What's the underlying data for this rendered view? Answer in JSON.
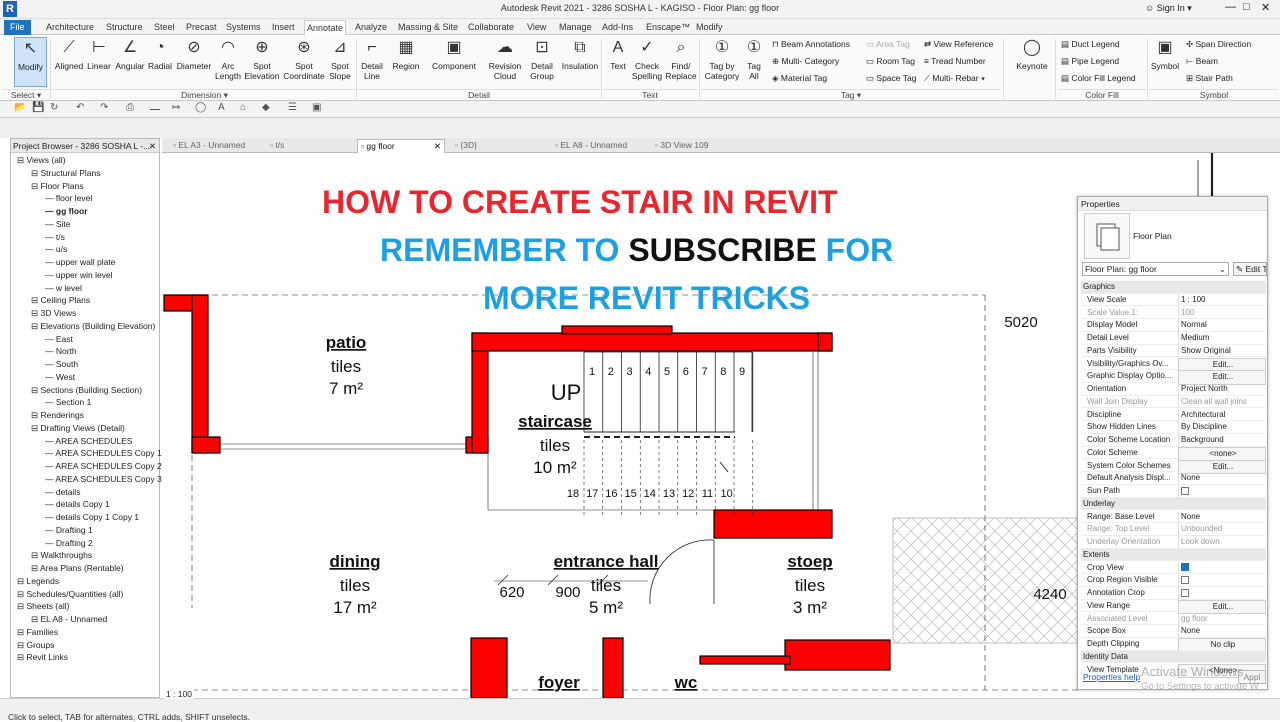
{
  "window": {
    "title": "Autodesk Revit 2021 - 3286 SOSHA L - KAGISO - Floor Plan: gg floor",
    "sign_in": "Sign In",
    "app_letter": "R"
  },
  "ribbon_tabs": [
    "File",
    "Architecture",
    "Structure",
    "Steel",
    "Precast",
    "Systems",
    "Insert",
    "Annotate",
    "Analyze",
    "Massing & Site",
    "Collaborate",
    "View",
    "Manage",
    "Add-Ins",
    "Enscape™",
    "Modify"
  ],
  "active_tab": "Annotate",
  "ribbon": {
    "modify": "Modify",
    "select": "Select ▾",
    "dimension": [
      "Aligned",
      "Linear",
      "Angular",
      "Radial",
      "Diameter",
      "Arc Length",
      "Spot Elevation",
      "Spot Coordinate",
      "Spot Slope"
    ],
    "dimension_group": "Dimension ▾",
    "detail": [
      "Detail Line",
      "Region",
      "Component",
      "Revision Cloud",
      "Detail Group",
      "Insulation"
    ],
    "detail_group": "Detail",
    "text": [
      "Text",
      "Check Spelling",
      "Find/ Replace"
    ],
    "text_group": "Text",
    "tag": [
      "Tag by Category",
      "Tag All"
    ],
    "tag_small": [
      "Beam Annotations",
      "Multi- Category",
      "Material Tag",
      "Area Tag",
      "Room Tag",
      "Space Tag",
      "View Reference",
      "Tread Number",
      "Multi- Rebar ▾"
    ],
    "tag_group": "Tag ▾",
    "keynote": "Keynote",
    "colorfill_small": [
      "Duct Legend",
      "Pipe Legend",
      "Color Fill Legend"
    ],
    "colorfill_group": "Color Fill",
    "symbol": "Symbol",
    "symbol_small": [
      "Span Direction",
      "Beam",
      "Stair Path"
    ],
    "symbol_group": "Symbol"
  },
  "project_browser": {
    "title": "Project Browser - 3286 SOSHA L -...",
    "items": [
      {
        "label": "Views (all)",
        "level": 0
      },
      {
        "label": "Structural Plans",
        "level": 1
      },
      {
        "label": "Floor Plans",
        "level": 1
      },
      {
        "label": "floor level",
        "level": 2
      },
      {
        "label": "gg floor",
        "level": 2,
        "selected": true
      },
      {
        "label": "Site",
        "level": 2
      },
      {
        "label": "t/s",
        "level": 2
      },
      {
        "label": "u/s",
        "level": 2
      },
      {
        "label": "upper wall plate",
        "level": 2
      },
      {
        "label": "upper win level",
        "level": 2
      },
      {
        "label": "w level",
        "level": 2
      },
      {
        "label": "Ceiling Plans",
        "level": 1
      },
      {
        "label": "3D Views",
        "level": 1
      },
      {
        "label": "Elevations (Building Elevation)",
        "level": 1
      },
      {
        "label": "East",
        "level": 2
      },
      {
        "label": "North",
        "level": 2
      },
      {
        "label": "South",
        "level": 2
      },
      {
        "label": "West",
        "level": 2
      },
      {
        "label": "Sections (Building Section)",
        "level": 1
      },
      {
        "label": "Section 1",
        "level": 2
      },
      {
        "label": "Renderings",
        "level": 1
      },
      {
        "label": "Drafting Views (Detail)",
        "level": 1
      },
      {
        "label": "AREA SCHEDULES",
        "level": 2
      },
      {
        "label": "AREA SCHEDULES Copy 1",
        "level": 2
      },
      {
        "label": "AREA SCHEDULES Copy 2",
        "level": 2
      },
      {
        "label": "AREA SCHEDULES Copy 3",
        "level": 2
      },
      {
        "label": "details",
        "level": 2
      },
      {
        "label": "details Copy 1",
        "level": 2
      },
      {
        "label": "details Copy 1 Copy 1",
        "level": 2
      },
      {
        "label": "Drafting 1",
        "level": 2
      },
      {
        "label": "Drafting 2",
        "level": 2
      },
      {
        "label": "Walkthroughs",
        "level": 1
      },
      {
        "label": "Area Plans (Rentable)",
        "level": 1
      },
      {
        "label": "Legends",
        "level": 0
      },
      {
        "label": "Schedules/Quantities (all)",
        "level": 0
      },
      {
        "label": "Sheets (all)",
        "level": 0
      },
      {
        "label": "EL A8 - Unnamed",
        "level": 1
      },
      {
        "label": "Families",
        "level": 0
      },
      {
        "label": "Groups",
        "level": 0
      },
      {
        "label": "Revit Links",
        "level": 0
      }
    ]
  },
  "doc_tabs": [
    {
      "label": "EL A3 - Unnamed",
      "active": false
    },
    {
      "label": "t/s",
      "active": false
    },
    {
      "label": "gg floor",
      "active": true
    },
    {
      "label": "{3D}",
      "active": false
    },
    {
      "label": "EL A8 - Unnamed",
      "active": false
    },
    {
      "label": "3D View 109",
      "active": false
    }
  ],
  "overlay": {
    "line1": "HOW TO CREATE STAIR IN REVIT",
    "line2a": "REMEMBER TO ",
    "line2b": "SUBSCRIBE",
    "line2c": " FOR",
    "line3": "MORE REVIT TRICKS",
    "colors": {
      "red": "#e8262d",
      "blue": "#1ea0e0",
      "black": "#111111"
    }
  },
  "plan": {
    "rooms": [
      {
        "name": "patio",
        "finish": "tiles",
        "area": "7 m²"
      },
      {
        "name": "staircase",
        "finish": "tiles",
        "area": "10 m²"
      },
      {
        "name": "dining",
        "finish": "tiles",
        "area": "17 m²"
      },
      {
        "name": "entrance hall",
        "finish": "tiles",
        "area": "5 m²"
      },
      {
        "name": "stoep",
        "finish": "tiles",
        "area": "3 m²"
      },
      {
        "name": "foyer"
      },
      {
        "name": "wc"
      }
    ],
    "up_label": "UP",
    "tread_top": [
      "1",
      "2",
      "3",
      "4",
      "5",
      "6",
      "7",
      "8",
      "9"
    ],
    "tread_bottom": [
      "18",
      "17",
      "16",
      "15",
      "14",
      "13",
      "12",
      "11",
      "10"
    ],
    "dims": [
      "5020",
      "4240",
      "620",
      "900"
    ],
    "wall_color": "#ff0000"
  },
  "properties": {
    "title": "Properties",
    "type_name": "Floor Plan",
    "selector": "Floor Plan: gg floor",
    "edit_type": "Edit T",
    "rows": [
      {
        "k": "Graphics",
        "sect": true
      },
      {
        "k": "View Scale",
        "v": "1 : 100"
      },
      {
        "k": "Scale Value    1:",
        "v": "100",
        "dis": true
      },
      {
        "k": "Display Model",
        "v": "Normal"
      },
      {
        "k": "Detail Level",
        "v": "Medium"
      },
      {
        "k": "Parts Visibility",
        "v": "Show Original"
      },
      {
        "k": "Visibility/Graphics Ov...",
        "v": "Edit...",
        "btn": true
      },
      {
        "k": "Graphic Display Optio...",
        "v": "Edit...",
        "btn": true
      },
      {
        "k": "Orientation",
        "v": "Project North"
      },
      {
        "k": "Wall Join Display",
        "v": "Clean all wall joins",
        "dis": true
      },
      {
        "k": "Discipline",
        "v": "Architectural"
      },
      {
        "k": "Show Hidden Lines",
        "v": "By Discipline"
      },
      {
        "k": "Color Scheme Location",
        "v": "Background"
      },
      {
        "k": "Color Scheme",
        "v": "<none>",
        "btn": true
      },
      {
        "k": "System Color Schemes",
        "v": "Edit...",
        "btn": true
      },
      {
        "k": "Default Analysis Displ...",
        "v": "None"
      },
      {
        "k": "Sun Path",
        "chk": false
      },
      {
        "k": "Underlay",
        "sect": true
      },
      {
        "k": "Range: Base Level",
        "v": "None"
      },
      {
        "k": "Range: Top Level",
        "v": "Unbounded",
        "dis": true
      },
      {
        "k": "Underlay Orientation",
        "v": "Look down",
        "dis": true
      },
      {
        "k": "Extents",
        "sect": true
      },
      {
        "k": "Crop View",
        "chk": true
      },
      {
        "k": "Crop Region Visible",
        "chk": false
      },
      {
        "k": "Annotation Crop",
        "chk": false
      },
      {
        "k": "View Range",
        "v": "Edit...",
        "btn": true
      },
      {
        "k": "Associated Level",
        "v": "gg floor",
        "dis": true
      },
      {
        "k": "Scope Box",
        "v": "None"
      },
      {
        "k": "Depth Clipping",
        "v": "No clip",
        "btn": true
      },
      {
        "k": "Identity Data",
        "sect": true
      },
      {
        "k": "View Template",
        "v": "<None>",
        "btn": true
      }
    ],
    "help": "Properties help",
    "apply": "Appl"
  },
  "watermark": {
    "line1": "Activate Windows",
    "line2": "Go to Settings to activate W"
  },
  "scale": "1 : 100",
  "status": "Click to select, TAB for alternates, CTRL adds, SHIFT unselects."
}
